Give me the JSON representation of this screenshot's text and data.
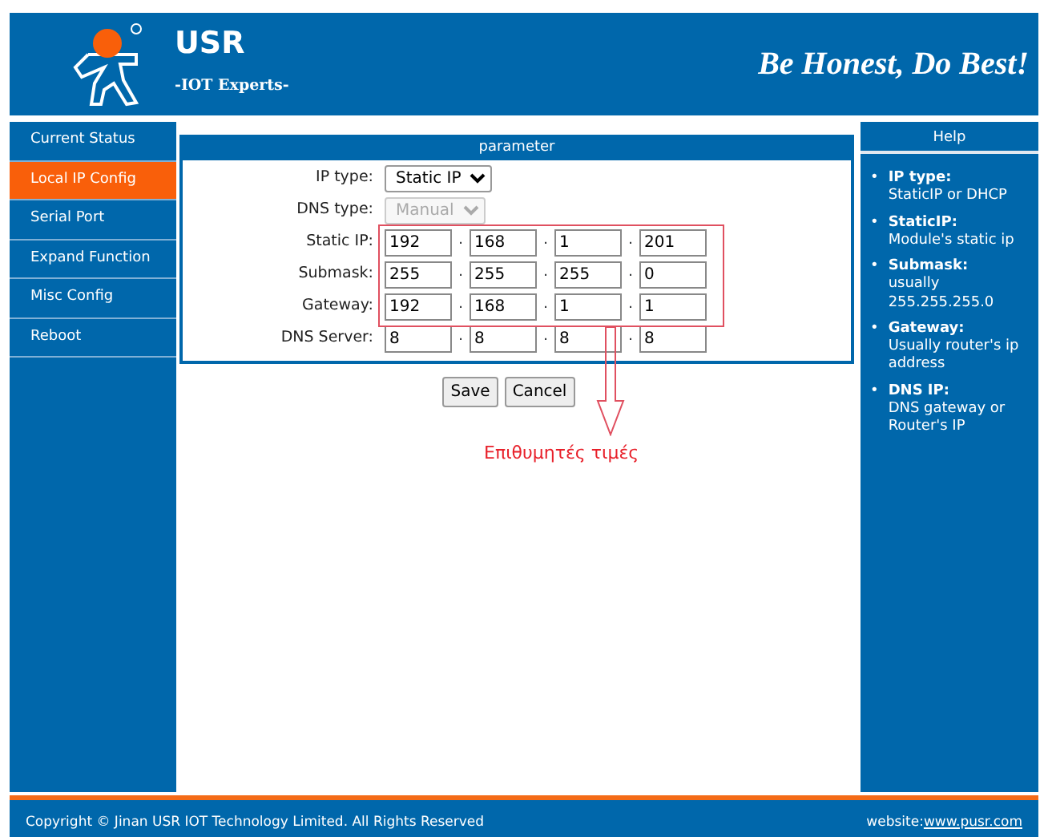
{
  "header": {
    "brand": "USR",
    "subtitle": "-IOT Experts-",
    "slogan": "Be Honest, Do Best!"
  },
  "sidebar": {
    "items": [
      {
        "label": "Current Status",
        "selected": false
      },
      {
        "label": "Local IP Config",
        "selected": true
      },
      {
        "label": "Serial Port",
        "selected": false
      },
      {
        "label": "Expand Function",
        "selected": false
      },
      {
        "label": "Misc Config",
        "selected": false
      },
      {
        "label": "Reboot",
        "selected": false
      }
    ]
  },
  "panel": {
    "title": "parameter",
    "separator": ".",
    "fields": [
      {
        "kind": "select",
        "label": "IP type:",
        "value": "Static IP",
        "disabled": false
      },
      {
        "kind": "select",
        "label": "DNS type:",
        "value": "Manual",
        "disabled": true
      },
      {
        "kind": "ip",
        "label": "Static IP:",
        "octets": [
          "192",
          "168",
          "1",
          "201"
        ]
      },
      {
        "kind": "ip",
        "label": "Submask:",
        "octets": [
          "255",
          "255",
          "255",
          "0"
        ]
      },
      {
        "kind": "ip",
        "label": "Gateway:",
        "octets": [
          "192",
          "168",
          "1",
          "1"
        ]
      },
      {
        "kind": "ip",
        "label": "DNS Server:",
        "octets": [
          "8",
          "8",
          "8",
          "8"
        ]
      }
    ],
    "buttons": [
      "Save",
      "Cancel"
    ]
  },
  "annotation": {
    "text": "Επιθυμητές τιμές"
  },
  "help": {
    "title": "Help",
    "bullet": "•",
    "items": [
      {
        "term": "IP type:",
        "text": "StaticIP or DHCP"
      },
      {
        "term": "StaticIP:",
        "text": "Module's static ip"
      },
      {
        "term": "Submask:",
        "text": "usually 255.255.255.0"
      },
      {
        "term": "Gateway:",
        "text": "Usually router's ip address"
      },
      {
        "term": "DNS IP:",
        "text": "DNS gateway or Router's IP"
      }
    ]
  },
  "footer": {
    "copyright": "Copyright © Jinan USR IOT Technology Limited. All Rights Reserved",
    "website_label": "website:",
    "website_link": "www.pusr.com"
  }
}
